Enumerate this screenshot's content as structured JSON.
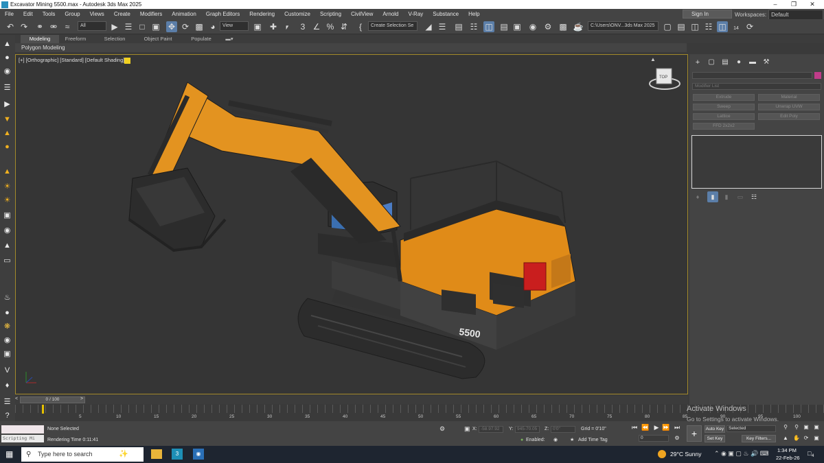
{
  "window": {
    "title": "Excavator Mining 5500.max - Autodesk 3ds Max 2025"
  },
  "menu": [
    "File",
    "Edit",
    "Tools",
    "Group",
    "Views",
    "Create",
    "Modifiers",
    "Animation",
    "Graph Editors",
    "Rendering",
    "Customize",
    "Scripting",
    "CivilView",
    "Arnold",
    "V-Ray",
    "Substance",
    "Help"
  ],
  "signin": {
    "label": "Sign In"
  },
  "workspaces": {
    "label": "Workspaces:",
    "value": "Default"
  },
  "toolbar": {
    "filter_value": "All",
    "view_value": "View",
    "selection_set_placeholder": "Create Selection Se",
    "path_value": "C:\\Users\\ONV...3ds Max 2025",
    "frame_badge": "14"
  },
  "ribbon": {
    "tabs": [
      "Modeling",
      "Freeform",
      "Selection",
      "Object Paint",
      "Populate"
    ],
    "active_tab": "Modeling",
    "panel_label": "Polygon Modeling"
  },
  "viewport": {
    "label": "[+] [Orthographic] [Standard] [Default Shading]",
    "viewcube_face": "TOP",
    "model_number": "5500"
  },
  "command_panel": {
    "modifier_list": "Modifier List",
    "buttons": [
      "Extrude",
      "Material",
      "Sweep",
      "Lathe",
      "Edit Poly",
      "Lattice",
      "FFD 2x2x2",
      "Unwrap UVW"
    ]
  },
  "time_slider": {
    "value": "0 / 100"
  },
  "track_ticks": [
    "5",
    "10",
    "15",
    "20",
    "25",
    "30",
    "35",
    "40",
    "45",
    "50",
    "55",
    "60",
    "65",
    "70",
    "75",
    "80",
    "85",
    "90",
    "95",
    "100"
  ],
  "status": {
    "selection": "None Selected",
    "render_time": "Rendering Time  0:11:41",
    "maxscript_label": "Scripting Mi",
    "x_value": "-58.97.92",
    "y_value": "945-70.05",
    "z_value": "0'0\"",
    "grid": "Grid = 0'10\"",
    "enabled": "Enabled:",
    "add_time_tag": "Add Time Tag",
    "auto_key": "Auto Key",
    "set_key": "Set Key",
    "selected": "Selected",
    "key_filters": "Key Filters...",
    "frame": "0"
  },
  "activation": {
    "title": "Activate Windows",
    "subtitle": "Go to Settings to activate Windows."
  },
  "taskbar": {
    "search_placeholder": "Type here to search",
    "weather": "29°C  Sunny",
    "time": "1:34 PM",
    "date": "22-Feb-26",
    "notification_count": "4"
  }
}
